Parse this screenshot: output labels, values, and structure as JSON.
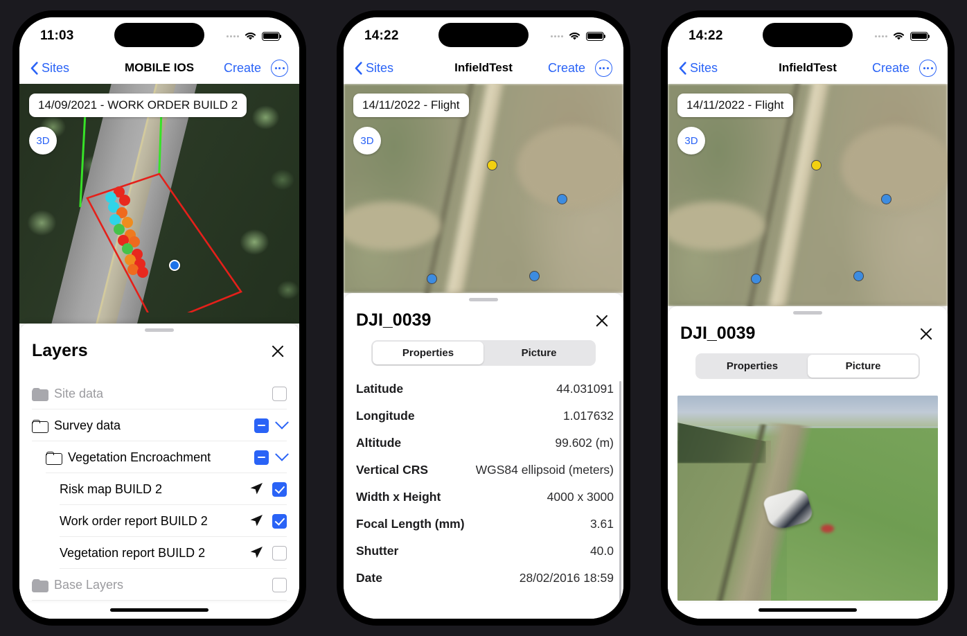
{
  "colors": {
    "accent": "#2a63f6",
    "marker_blue": "#3d8ce0",
    "marker_yellow": "#f2d010",
    "polygon_red": "#e4201a",
    "line_green": "#37e228",
    "background": "#1b1a1f"
  },
  "phones": [
    {
      "status": {
        "time": "11:03",
        "wifi_icon": "wifi-icon",
        "battery_icon": "battery-icon",
        "signal_icon": "signal-dots-icon"
      },
      "nav": {
        "back_label": "Sites",
        "back_icon": "chevron-left-icon",
        "title": "MOBILE IOS",
        "create_label": "Create",
        "more_icon": "ellipsis-circle-icon"
      },
      "map": {
        "date_chip": "14/09/2021 - WORK ORDER BUILD 2",
        "view_toggle": "3D"
      },
      "sheet": {
        "title": "Layers",
        "close_icon": "close-icon",
        "rows": [
          {
            "label": "Site data",
            "indent": 0,
            "folder": "folder-icon",
            "muted": true,
            "checkbox": "unchecked",
            "chevron": false,
            "arrow": false
          },
          {
            "label": "Survey data",
            "indent": 0,
            "folder": "folder-icon",
            "muted": false,
            "checkbox": "partial",
            "chevron": true,
            "arrow": false
          },
          {
            "label": "Vegetation Encroachment",
            "indent": 1,
            "folder": "folder-icon",
            "muted": false,
            "checkbox": "partial",
            "chevron": true,
            "arrow": false
          },
          {
            "label": "Risk map BUILD 2",
            "indent": 2,
            "folder": null,
            "muted": false,
            "checkbox": "checked",
            "chevron": false,
            "arrow": true
          },
          {
            "label": "Work order report BUILD 2",
            "indent": 2,
            "folder": null,
            "muted": false,
            "checkbox": "checked",
            "chevron": false,
            "arrow": true
          },
          {
            "label": "Vegetation report BUILD 2",
            "indent": 2,
            "folder": null,
            "muted": false,
            "checkbox": "unchecked",
            "chevron": false,
            "arrow": true
          },
          {
            "label": "Base Layers",
            "indent": 0,
            "folder": "folder-icon",
            "muted": true,
            "checkbox": "unchecked",
            "chevron": false,
            "arrow": false
          }
        ]
      }
    },
    {
      "status": {
        "time": "14:22",
        "wifi_icon": "wifi-icon",
        "battery_icon": "battery-icon",
        "signal_icon": "signal-dots-icon"
      },
      "nav": {
        "back_label": "Sites",
        "back_icon": "chevron-left-icon",
        "title": "InfieldTest",
        "create_label": "Create",
        "more_icon": "ellipsis-circle-icon"
      },
      "map": {
        "date_chip": "14/11/2022 - Flight",
        "view_toggle": "3D"
      },
      "sheet": {
        "title": "DJI_0039",
        "close_icon": "close-icon",
        "tabs": [
          {
            "label": "Properties",
            "active": true
          },
          {
            "label": "Picture",
            "active": false
          }
        ],
        "properties": [
          {
            "key": "Latitude",
            "value": "44.031091"
          },
          {
            "key": "Longitude",
            "value": "1.017632"
          },
          {
            "key": "Altitude",
            "value": "99.602 (m)"
          },
          {
            "key": "Vertical CRS",
            "value": "WGS84 ellipsoid (meters)"
          },
          {
            "key": "Width x Height",
            "value": "4000 x 3000"
          },
          {
            "key": "Focal Length (mm)",
            "value": "3.61"
          },
          {
            "key": "Shutter",
            "value": "40.0"
          },
          {
            "key": "Date",
            "value": "28/02/2016 18:59"
          }
        ]
      }
    },
    {
      "status": {
        "time": "14:22",
        "wifi_icon": "wifi-icon",
        "battery_icon": "battery-icon",
        "signal_icon": "signal-dots-icon"
      },
      "nav": {
        "back_label": "Sites",
        "back_icon": "chevron-left-icon",
        "title": "InfieldTest",
        "create_label": "Create",
        "more_icon": "ellipsis-circle-icon"
      },
      "map": {
        "date_chip": "14/11/2022 - Flight",
        "view_toggle": "3D"
      },
      "sheet": {
        "title": "DJI_0039",
        "close_icon": "close-icon",
        "tabs": [
          {
            "label": "Properties",
            "active": false
          },
          {
            "label": "Picture",
            "active": true
          }
        ],
        "photo_alt": "aerial-drone-photo-field-track-overturned-vehicle"
      }
    }
  ]
}
